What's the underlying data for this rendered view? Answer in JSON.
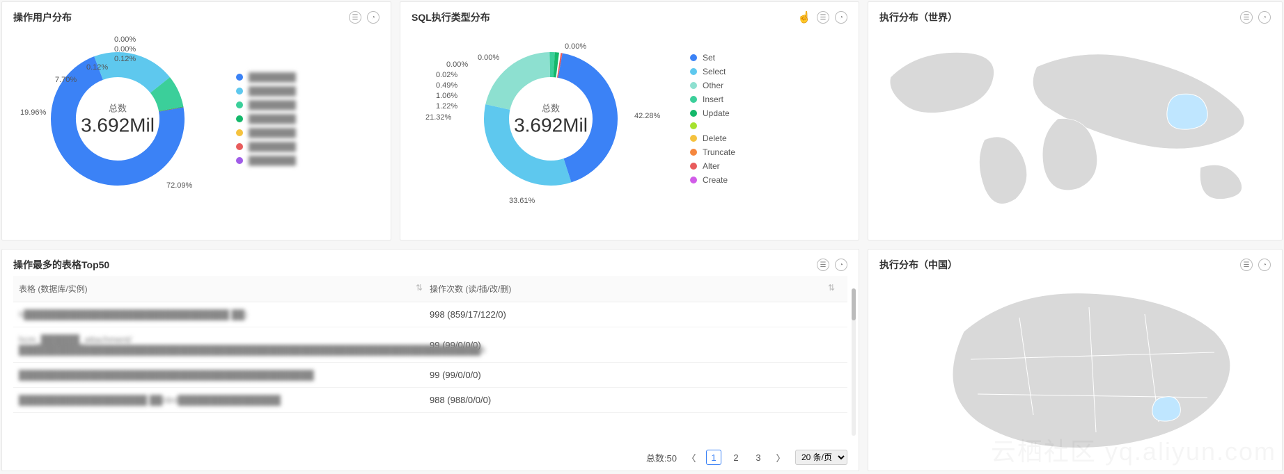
{
  "panels": {
    "userDist": {
      "title": "操作用户分布"
    },
    "sqlDist": {
      "title": "SQL执行类型分布"
    },
    "worldMap": {
      "title": "执行分布（世界）"
    },
    "top50": {
      "title": "操作最多的表格Top50"
    },
    "chinaMap": {
      "title": "执行分布（中国）"
    }
  },
  "donut": {
    "centerLabel": "总数",
    "centerValue": "3.692Mil"
  },
  "chart_data": [
    {
      "type": "pie",
      "title": "操作用户分布",
      "total_label": "总数",
      "total_value": "3.692Mil",
      "series": [
        {
          "name": "user_1",
          "value": 72.09
        },
        {
          "name": "user_2",
          "value": 19.96
        },
        {
          "name": "user_3",
          "value": 7.7
        },
        {
          "name": "user_4",
          "value": 0.12
        },
        {
          "name": "user_5",
          "value": 0.12
        },
        {
          "name": "user_6",
          "value": 0.0
        },
        {
          "name": "user_7",
          "value": 0.0
        }
      ],
      "slice_labels": [
        "72.09%",
        "19.96%",
        "7.70%",
        "0.12%",
        "0.12%",
        "0.00%",
        "0.00%"
      ],
      "legend_items": [
        "(redacted)",
        "(redacted)",
        "(redacted)",
        "(redacted)",
        "(redacted)",
        "(redacted)",
        "(redacted)"
      ],
      "colors": [
        "#3b82f6",
        "#5ec8ee",
        "#3bcf9a",
        "#14b86a",
        "#f5c23e",
        "#e85c5c",
        "#a05ce8"
      ]
    },
    {
      "type": "pie",
      "title": "SQL执行类型分布",
      "total_label": "总数",
      "total_value": "3.692Mil",
      "series": [
        {
          "name": "Set",
          "value": 42.28
        },
        {
          "name": "Select",
          "value": 33.61
        },
        {
          "name": "Other",
          "value": 21.32
        },
        {
          "name": "Insert",
          "value": 1.22
        },
        {
          "name": "Update",
          "value": 1.06
        },
        {
          "name": "",
          "value": 0.49
        },
        {
          "name": "Delete",
          "value": 0.02
        },
        {
          "name": "Truncate",
          "value": 0.0
        },
        {
          "name": "Alter",
          "value": 0.0
        },
        {
          "name": "Create",
          "value": 0.0
        }
      ],
      "slice_labels": [
        "42.28%",
        "33.61%",
        "21.32%",
        "1.22%",
        "1.06%",
        "0.49%",
        "0.02%",
        "0.00%",
        "0.00%",
        "0.00%"
      ],
      "legend_items": [
        "Set",
        "Select",
        "Other",
        "Insert",
        "Update",
        "",
        "Delete",
        "Truncate",
        "Alter",
        "Create"
      ],
      "colors": [
        "#3b82f6",
        "#5ec8ee",
        "#8de0d0",
        "#3bcf9a",
        "#14b86a",
        "#a6e22e",
        "#f5c23e",
        "#f5873e",
        "#e85c5c",
        "#d15ce8"
      ]
    }
  ],
  "userLegend": [
    {
      "color": "#3b82f6",
      "label": "████████"
    },
    {
      "color": "#5ec8ee",
      "label": "████████"
    },
    {
      "color": "#3bcf9a",
      "label": "████████"
    },
    {
      "color": "#14b86a",
      "label": "████████"
    },
    {
      "color": "#f5c23e",
      "label": "████████"
    },
    {
      "color": "#e85c5c",
      "label": "████████"
    },
    {
      "color": "#a05ce8",
      "label": "████████"
    }
  ],
  "userSliceLabels": {
    "s0": "72.09%",
    "s1": "19.96%",
    "s2": "7.70%",
    "s3": "0.12%",
    "s4": "0.12%",
    "s5": "0.00%",
    "s6": "0.00%"
  },
  "sqlLegend": [
    {
      "color": "#3b82f6",
      "label": "Set"
    },
    {
      "color": "#5ec8ee",
      "label": "Select"
    },
    {
      "color": "#8de0d0",
      "label": "Other"
    },
    {
      "color": "#3bcf9a",
      "label": "Insert"
    },
    {
      "color": "#14b86a",
      "label": "Update"
    },
    {
      "color": "#a6e22e",
      "label": ""
    },
    {
      "color": "#f5c23e",
      "label": "Delete"
    },
    {
      "color": "#f5873e",
      "label": "Truncate"
    },
    {
      "color": "#e85c5c",
      "label": "Alter"
    },
    {
      "color": "#d15ce8",
      "label": "Create"
    }
  ],
  "sqlSliceLabels": {
    "s0": "42.28%",
    "s1": "33.61%",
    "s2": "21.32%",
    "s3": "1.22%",
    "s4": "1.06%",
    "s5": "0.49%",
    "s6": "0.02%",
    "s7": "0.00%",
    "s8": "0.00%",
    "s9": "0.00%"
  },
  "table": {
    "col0": "表格 (数据库/实例)",
    "col1": "操作次数 (读/插/改/删)",
    "rows": [
      {
        "name": "h████████████████████████████████ ██)",
        "ops": "998 (859/17/122/0)"
      },
      {
        "name": "hcm_██████_attachment/████████████████████████████████████████████████████████████████████████6",
        "ops": "99 (99/0/0/0)"
      },
      {
        "name": "██████████████████████████████████████████████",
        "ops": "99 (99/0/0/0)"
      },
      {
        "name": "████████████████████ ██/drd████████████████",
        "ops": "988 (988/0/0/0)"
      }
    ]
  },
  "pager": {
    "total": "总数:50",
    "p1": "1",
    "p2": "2",
    "p3": "3",
    "perPage": "20 条/页"
  },
  "watermark": "云栖社区 yq.aliyun.com"
}
